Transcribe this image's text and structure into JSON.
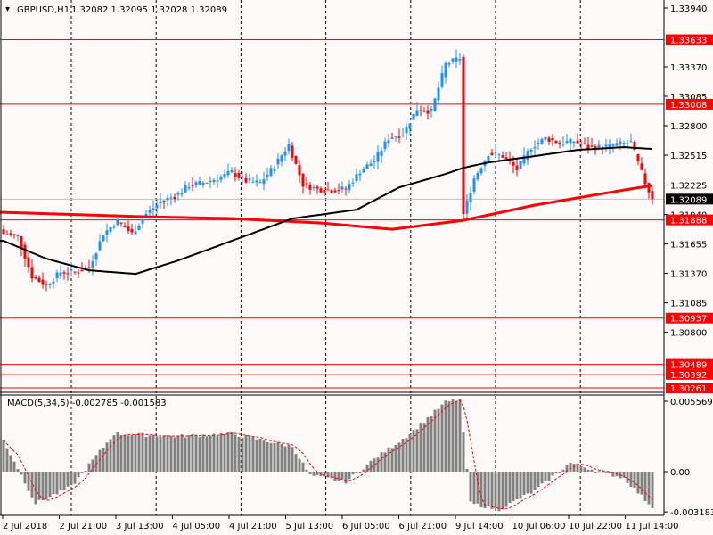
{
  "header": {
    "symbol": "GBPUSD,H1",
    "ohlc": "1.32082 1.32095 1.32028 1.32089"
  },
  "macd_label": "MACD(5,34,5) -0.002785 -0.001583",
  "colors": {
    "background": "#fffafa",
    "bull": "#1e90ff",
    "bear": "#ff0000",
    "level_line": "#ff0000",
    "ma_slow": "#ff0000",
    "ma_fast": "#000000",
    "histogram": "#808080",
    "current_price_tag": "#000000"
  },
  "chart_data": {
    "type": "candlestick",
    "title": "GBPUSD,H1",
    "y_axis_ticks": [
      "1.33940",
      "1.33370",
      "1.33085",
      "1.32800",
      "1.32515",
      "1.32225",
      "1.31940",
      "1.31655",
      "1.31370",
      "1.31085",
      "1.30800"
    ],
    "y_range": [
      1.3023,
      1.34018
    ],
    "x_tick_labels": [
      "2 Jul 2018",
      "2 Jul 21:00",
      "3 Jul 13:00",
      "4 Jul 05:00",
      "4 Jul 21:00",
      "5 Jul 13:00",
      "6 Jul 05:00",
      "6 Jul 21:00",
      "9 Jul 14:00",
      "10 Jul 06:00",
      "10 Jul 22:00",
      "11 Jul 14:00"
    ],
    "bars_total": 183,
    "close_keyframes": {
      "bar_index": [
        0,
        4,
        8,
        12,
        16,
        20,
        24,
        28,
        32,
        36,
        40,
        44,
        48,
        52,
        56,
        60,
        64,
        68,
        72,
        76,
        80,
        84,
        88,
        92,
        96,
        100,
        104,
        108,
        112,
        116,
        120,
        124,
        128,
        129,
        132,
        136,
        140,
        144,
        148,
        152,
        156,
        160,
        164,
        168,
        172,
        176,
        180,
        182
      ],
      "close": [
        1.31755,
        1.31729,
        1.3134,
        1.31253,
        1.31383,
        1.31383,
        1.31426,
        1.31755,
        1.31875,
        1.31755,
        1.31944,
        1.32065,
        1.32117,
        1.32221,
        1.32247,
        1.3229,
        1.3235,
        1.32264,
        1.32247,
        1.32411,
        1.32618,
        1.32229,
        1.32186,
        1.32178,
        1.32186,
        1.32359,
        1.32463,
        1.32679,
        1.32722,
        1.32964,
        1.32938,
        1.33396,
        1.33456,
        1.3194,
        1.3229,
        1.32532,
        1.32506,
        1.32376,
        1.32592,
        1.32679,
        1.32635,
        1.3265,
        1.32592,
        1.32592,
        1.3262,
        1.32635,
        1.32247,
        1.32089
      ]
    },
    "ma_slow_keyframes": {
      "bar_index": [
        0,
        40,
        64,
        89,
        109,
        129,
        149,
        174,
        182
      ],
      "value": [
        1.31961,
        1.31918,
        1.31901,
        1.31858,
        1.31797,
        1.31884,
        1.32031,
        1.32177,
        1.32221
      ]
    },
    "ma_fast_keyframes": {
      "bar_index": [
        0,
        12,
        24,
        37,
        49,
        64,
        81,
        99,
        111,
        124,
        129,
        136,
        149,
        161,
        174,
        182
      ],
      "value": [
        1.31685,
        1.31512,
        1.314,
        1.31365,
        1.31495,
        1.31685,
        1.31901,
        1.31987,
        1.32203,
        1.32333,
        1.32393,
        1.32445,
        1.32506,
        1.32566,
        1.32592,
        1.32575
      ]
    },
    "levels": [
      {
        "label": "1.33633",
        "value": 1.33633
      },
      {
        "label": "1.33008",
        "value": 1.33008
      },
      {
        "label": "1.31888",
        "value": 1.31888
      },
      {
        "label": "1.30937",
        "value": 1.30937
      },
      {
        "label": "1.30489",
        "value": 1.30489
      },
      {
        "label": "1.30392",
        "value": 1.30392
      },
      {
        "label": "1.30261",
        "value": 1.30261
      }
    ],
    "current_price": {
      "label": "1.32089",
      "value": 1.32089
    },
    "macd": {
      "name": "MACD(5,34,5)",
      "main_value": -0.002785,
      "signal_value": -0.001583,
      "y_ticks": [
        "0.005569",
        "0.00",
        "-0.003183"
      ],
      "y_range": [
        -0.0035,
        0.006
      ],
      "hist_keyframes": {
        "bar_index": [
          0,
          9,
          19,
          31,
          49,
          64,
          81,
          86,
          96,
          104,
          114,
          124,
          128,
          131,
          139,
          149,
          159,
          166,
          174,
          182
        ],
        "value": [
          0.0025,
          -0.0025,
          -0.0012,
          0.003,
          0.0028,
          0.003,
          0.002,
          -0.0003,
          -0.0008,
          0.001,
          0.003,
          0.0055,
          0.0057,
          -0.0025,
          -0.003,
          -0.0015,
          0.0007,
          0.0001,
          -0.0005,
          -0.0028
        ]
      }
    }
  }
}
